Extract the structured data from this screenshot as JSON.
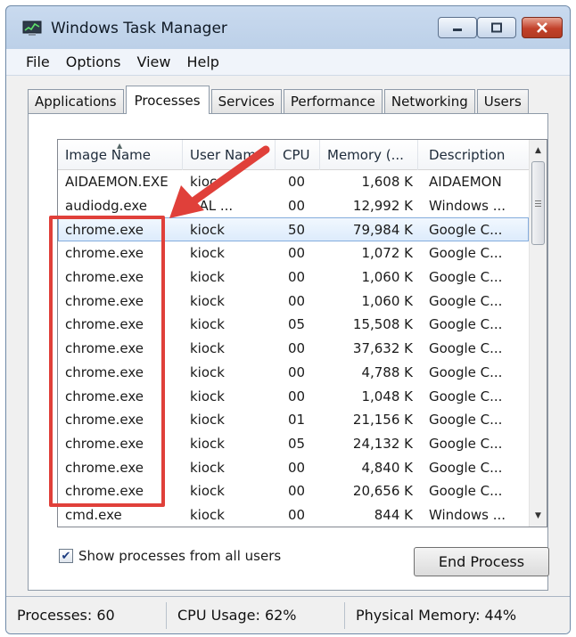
{
  "window": {
    "title": "Windows Task Manager"
  },
  "menu": [
    "File",
    "Options",
    "View",
    "Help"
  ],
  "tabs": [
    {
      "label": "Applications",
      "active": false
    },
    {
      "label": "Processes",
      "active": true
    },
    {
      "label": "Services",
      "active": false
    },
    {
      "label": "Performance",
      "active": false
    },
    {
      "label": "Networking",
      "active": false
    },
    {
      "label": "Users",
      "active": false
    }
  ],
  "processes": {
    "columns": [
      "Image Name",
      "User Nam",
      "CPU",
      "Memory (...",
      "Description"
    ],
    "rows": [
      {
        "name": "AIDAEMON.EXE",
        "user": "kioc",
        "cpu": "00",
        "memory": "1,608 K",
        "description": "AIDAEMON",
        "selected": false
      },
      {
        "name": "audiodg.exe",
        "user": "CAL ...",
        "cpu": "00",
        "memory": "12,992 K",
        "description": "Windows ...",
        "selected": false
      },
      {
        "name": "chrome.exe",
        "user": "kiock",
        "cpu": "50",
        "memory": "79,984 K",
        "description": "Google C...",
        "selected": true
      },
      {
        "name": "chrome.exe",
        "user": "kiock",
        "cpu": "00",
        "memory": "1,072 K",
        "description": "Google C...",
        "selected": false
      },
      {
        "name": "chrome.exe",
        "user": "kiock",
        "cpu": "00",
        "memory": "1,060 K",
        "description": "Google C...",
        "selected": false
      },
      {
        "name": "chrome.exe",
        "user": "kiock",
        "cpu": "00",
        "memory": "1,060 K",
        "description": "Google C...",
        "selected": false
      },
      {
        "name": "chrome.exe",
        "user": "kiock",
        "cpu": "05",
        "memory": "15,508 K",
        "description": "Google C...",
        "selected": false
      },
      {
        "name": "chrome.exe",
        "user": "kiock",
        "cpu": "00",
        "memory": "37,632 K",
        "description": "Google C...",
        "selected": false
      },
      {
        "name": "chrome.exe",
        "user": "kiock",
        "cpu": "00",
        "memory": "4,788 K",
        "description": "Google C...",
        "selected": false
      },
      {
        "name": "chrome.exe",
        "user": "kiock",
        "cpu": "00",
        "memory": "1,048 K",
        "description": "Google C...",
        "selected": false
      },
      {
        "name": "chrome.exe",
        "user": "kiock",
        "cpu": "01",
        "memory": "21,156 K",
        "description": "Google C...",
        "selected": false
      },
      {
        "name": "chrome.exe",
        "user": "kiock",
        "cpu": "05",
        "memory": "24,132 K",
        "description": "Google C...",
        "selected": false
      },
      {
        "name": "chrome.exe",
        "user": "kiock",
        "cpu": "00",
        "memory": "4,840 K",
        "description": "Google C...",
        "selected": false
      },
      {
        "name": "chrome.exe",
        "user": "kiock",
        "cpu": "00",
        "memory": "20,656 K",
        "description": "Google C...",
        "selected": false
      },
      {
        "name": "cmd.exe",
        "user": "kiock",
        "cpu": "00",
        "memory": "844 K",
        "description": "Windows ...",
        "selected": false
      }
    ]
  },
  "show_all_users": {
    "label": "Show processes from all users",
    "checked": true
  },
  "end_process_label": "End Process",
  "status": {
    "processes": "Processes: 60",
    "cpu": "CPU Usage: 62%",
    "memory": "Physical Memory: 44%"
  },
  "colors": {
    "annotation": "#e0403a",
    "selection": "#dcebfc"
  }
}
